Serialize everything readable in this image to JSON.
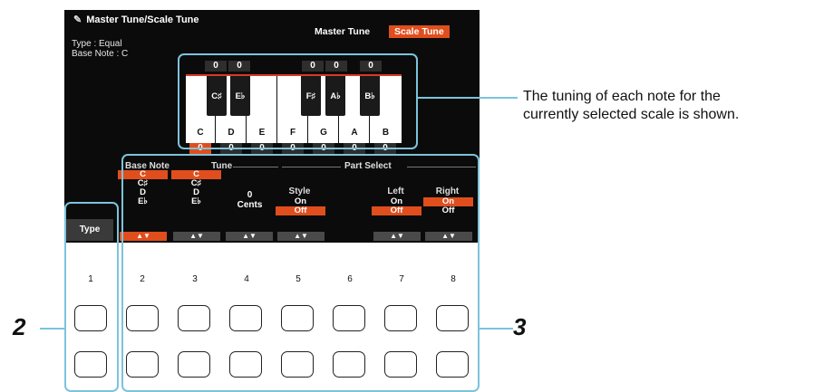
{
  "header": {
    "title": "Master Tune/Scale Tune",
    "tab_master": "Master Tune",
    "tab_scale": "Scale Tune"
  },
  "info": {
    "type_line": "Type : Equal",
    "base_note_line": "Base Note : C"
  },
  "keyboard": {
    "white_keys": [
      "C",
      "D",
      "E",
      "F",
      "G",
      "A",
      "B"
    ],
    "black_keys": [
      "C♯",
      "E♭",
      "F♯",
      "A♭",
      "B♭"
    ],
    "black_values": [
      "0",
      "0",
      "0",
      "0",
      "0"
    ],
    "white_values": [
      "0",
      "0",
      "0",
      "0",
      "0",
      "0",
      "0"
    ],
    "selected_index": 0
  },
  "panel": {
    "base_note_header": "Base Note",
    "tune_header": "Tune",
    "part_select_header": "Part Select",
    "base_note_options": [
      "C",
      "C♯",
      "D",
      "E♭"
    ],
    "tune_options": [
      "C",
      "C♯",
      "D",
      "E♭"
    ],
    "cents_value": "0",
    "cents_unit": "Cents",
    "style_label": "Style",
    "style_on": "On",
    "style_off": "Off",
    "left_label": "Left",
    "left_on": "On",
    "left_off": "Off",
    "right_label": "Right",
    "right_on": "On",
    "right_off": "Off",
    "type_button": "Type",
    "arrow": "▲▼"
  },
  "buttons": {
    "numbers": [
      "1",
      "2",
      "3",
      "4",
      "5",
      "6",
      "7",
      "8"
    ]
  },
  "annotations": {
    "callout_line1": "The tuning of each note for the",
    "callout_line2": "currently selected scale is shown.",
    "step_left": "2",
    "step_right": "3"
  },
  "colors": {
    "accent": "#e04e1d",
    "highlight": "#7cc3dc",
    "screen_bg": "#0b0b0b"
  }
}
